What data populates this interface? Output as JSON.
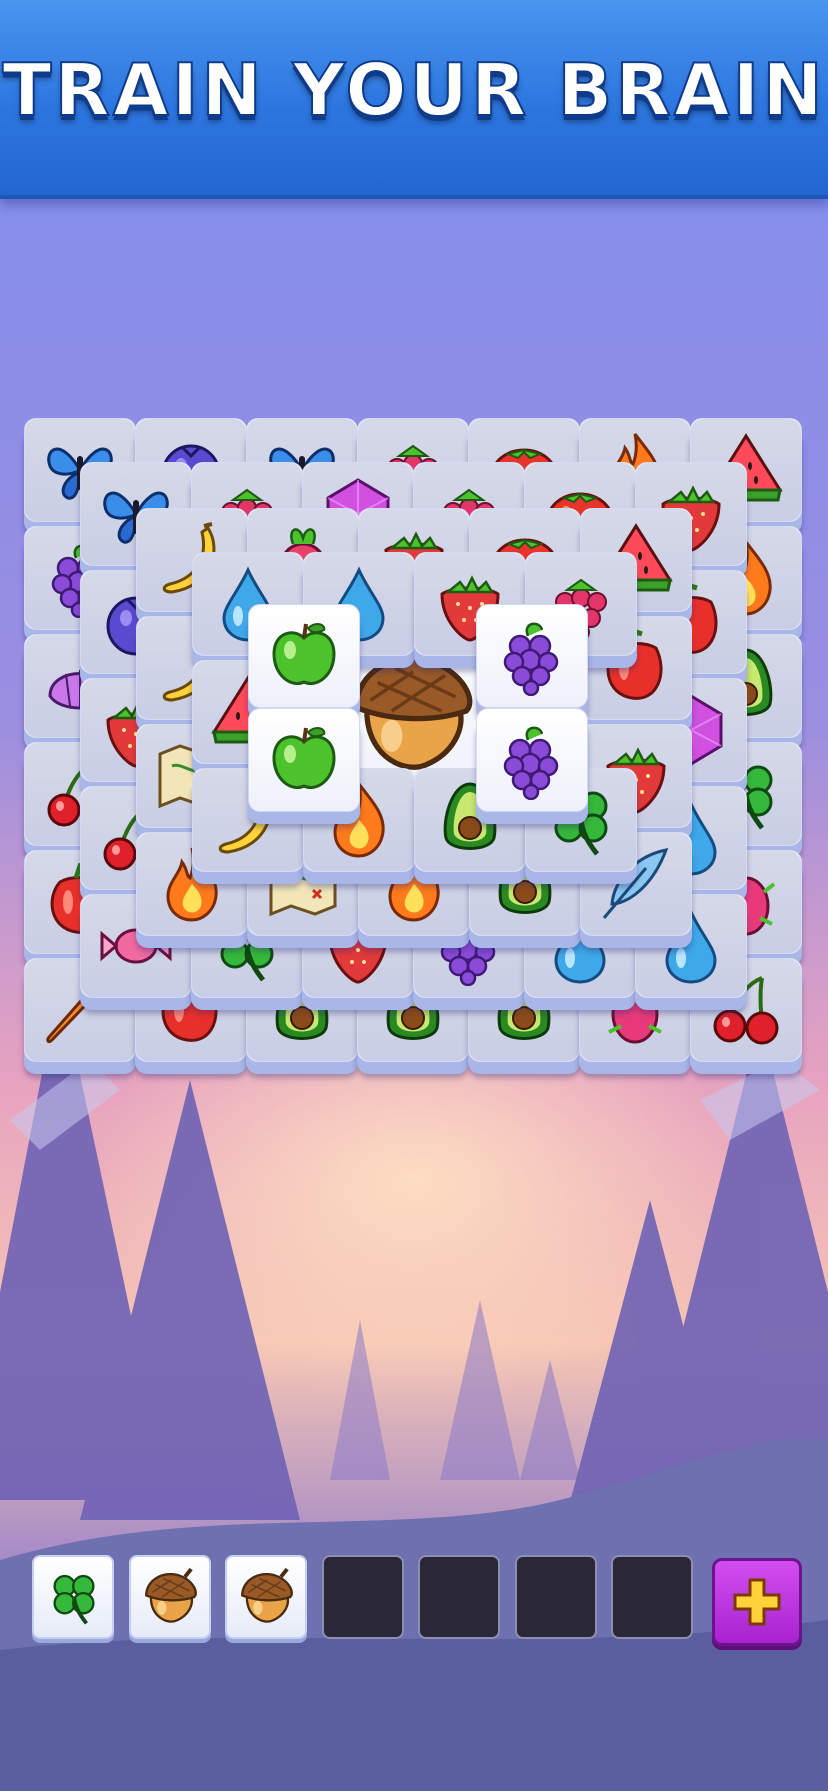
{
  "banner": {
    "title": "TRAIN YOUR BRAIN"
  },
  "colors": {
    "banner": "#2d76e0",
    "title_outline": "#0f3c8a",
    "tile_face": "#ffffff",
    "tray_slot_empty": "#2a2836",
    "add_button": "#c03be6",
    "add_icon": "#ffd23a"
  },
  "board": {
    "layers": [
      {
        "name": "layer-1",
        "tiles": [
          "butterfly",
          "blueberry",
          "butterfly",
          "raspberry",
          "tomato",
          "flame",
          "watermelon",
          "grapes",
          "",
          "",
          "",
          "",
          "",
          "flame",
          "shell",
          "",
          "",
          "",
          "",
          "",
          "avocado",
          "cherry",
          "",
          "",
          "",
          "",
          "",
          "clover",
          "pepper",
          "",
          "",
          "",
          "",
          "",
          "dragonfruit",
          "carrot",
          "pepper",
          "avocado",
          "avocado",
          "avocado",
          "dragonfruit",
          "cherry"
        ]
      },
      {
        "name": "layer-2",
        "tiles": [
          "butterfly",
          "raspberry",
          "gem",
          "raspberry",
          "tomato",
          "strawberry",
          "blueberry",
          "",
          "",
          "",
          "",
          "pepper",
          "strawberry",
          "",
          "",
          "",
          "",
          "gem",
          "cherry",
          "",
          "",
          "",
          "",
          "water",
          "candy",
          "clover",
          "strawberry",
          "grapes",
          "water",
          "water"
        ]
      },
      {
        "name": "layer-3",
        "tiles": [
          "banana",
          "radish",
          "strawberry",
          "tomato",
          "watermelon",
          "banana",
          "",
          "",
          "",
          "pepper",
          "map",
          "",
          "",
          "",
          "strawberry",
          "flame",
          "map",
          "flame",
          "avocado",
          "feather"
        ]
      },
      {
        "name": "layer-4",
        "tiles": [
          "water",
          "water",
          "strawberry",
          "raspberry",
          "watermelon",
          "",
          "",
          "",
          "banana",
          "flame",
          "avocado",
          "clover"
        ]
      },
      {
        "name": "layer-5",
        "tiles": [
          "apple",
          "grapes",
          "apple",
          "grapes"
        ]
      },
      {
        "name": "top",
        "tiles": [
          "acorn"
        ]
      }
    ]
  },
  "tray": {
    "slots": [
      "clover",
      "acorn",
      "acorn",
      "",
      "",
      "",
      ""
    ],
    "add_button_icon": "plus-icon"
  }
}
